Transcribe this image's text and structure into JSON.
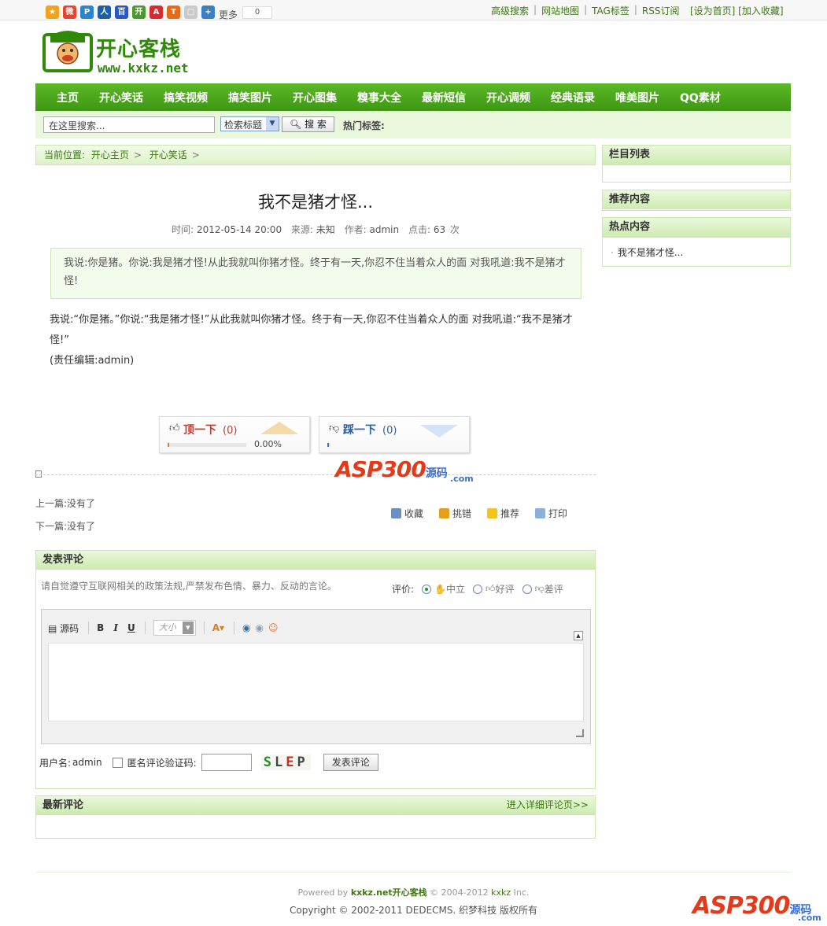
{
  "topbar": {
    "share_icons": [
      {
        "name": "qzone-icon",
        "color": "#f4a11c",
        "glyph": "★"
      },
      {
        "name": "weibo-icon",
        "color": "#e6442d",
        "glyph": "微"
      },
      {
        "name": "pengyou-icon",
        "color": "#2c84cf",
        "glyph": "P"
      },
      {
        "name": "renren-icon",
        "color": "#1f5ea8",
        "glyph": "人"
      },
      {
        "name": "baidu-icon",
        "color": "#2a57c4",
        "glyph": "百"
      },
      {
        "name": "kaixin-icon",
        "color": "#4a9a2a",
        "glyph": "开"
      },
      {
        "name": "sohu-icon",
        "color": "#d62c2c",
        "glyph": "A"
      },
      {
        "name": "taobao-icon",
        "color": "#e66a1a",
        "glyph": "T"
      },
      {
        "name": "copy-icon",
        "color": "#c9c9c9",
        "glyph": "□"
      },
      {
        "name": "more-share-icon",
        "color": "#3a80c9",
        "glyph": "+"
      }
    ],
    "more_label": "更多",
    "share_count": "0",
    "links": [
      "高级搜索",
      "网站地图",
      "TAG标签",
      "RSS订阅"
    ],
    "right_links": "[设为首页] [加入收藏]"
  },
  "logo": {
    "cn": "开心客栈",
    "en": "www.kxkz.net"
  },
  "nav": [
    "主页",
    "开心笑话",
    "搞笑视频",
    "搞笑图片",
    "开心图集",
    "糗事大全",
    "最新短信",
    "开心调频",
    "经典语录",
    "唯美图片",
    "QQ素材"
  ],
  "search": {
    "placeholder": "在这里搜索...",
    "select_value": "检索标题",
    "button": "搜 索",
    "hot_tags_label": "热门标签:"
  },
  "breadcrumb": {
    "prefix": "当前位置:",
    "items": [
      "开心主页",
      "开心笑话"
    ]
  },
  "article": {
    "title": "我不是猪才怪...",
    "meta_time_label": "时间:",
    "meta_time": "2012-05-14 20:00",
    "meta_source_label": "来源:",
    "meta_source": "未知",
    "meta_author_label": "作者:",
    "meta_author": "admin",
    "meta_clicks_label": "点击:",
    "meta_clicks": "63",
    "meta_clicks_unit": "次",
    "description": "我说:你是猪。你说:我是猪才怪!从此我就叫你猪才怪。终于有一天,你忍不住当着众人的面 对我吼道:我不是猪才怪!",
    "body_line1": "我说:“你是猪。”你说:“我是猪才怪!”从此我就叫你猪才怪。终于有一天,你忍不住当着众人的面 对我吼道:“我不是猪才怪!”",
    "body_editor": "(责任编辑:admin)"
  },
  "vote": {
    "up_label": "顶一下",
    "up_count": "(0)",
    "up_pct": "0.00%",
    "up_level": 0,
    "down_label": "踩一下",
    "down_count": "(0)",
    "down_level": 0,
    "up_color": "#c0392b",
    "down_color": "#2a5fa0"
  },
  "watermark": {
    "text": "ASP300",
    "zh": "源码",
    "com": ".com"
  },
  "prevnext": {
    "prev": "上一篇:没有了",
    "next": "下一篇:没有了"
  },
  "actions": [
    "收藏",
    "挑错",
    "推荐",
    "打印"
  ],
  "comment": {
    "header": "发表评论",
    "notice": "请自觉遵守互联网相关的政策法规,严禁发布色情、暴力、反动的言论。",
    "rating_label": "评价:",
    "rating_options": [
      "中立",
      "好评",
      "差评"
    ],
    "rating_selected": "中立",
    "toolbar_source": "源码",
    "toolbar_bold": "B",
    "toolbar_italic": "I",
    "toolbar_underline": "U",
    "toolbar_size": "大小",
    "username_label": "用户名:",
    "username": "admin",
    "anon_label": "匿名评论",
    "vcode_label": "验证码:",
    "captcha": [
      "S",
      "L",
      "E",
      "P"
    ],
    "submit": "发表评论"
  },
  "latest": {
    "header": "最新评论",
    "more": "进入详细评论页>>"
  },
  "sidebar": {
    "column_list": "栏目列表",
    "recommended": "推荐内容",
    "hot": "热点内容",
    "hot_items": [
      "我不是猪才怪..."
    ]
  },
  "footer": {
    "powered_prefix": "Powered by",
    "powered_site": "kxkz.net开心客栈",
    "powered_suffix": "© 2004-2012",
    "powered_brand": "kxkz",
    "powered_inc": "Inc.",
    "copyright": "Copyright © 2002-2011 DEDECMS. 织梦科技 版权所有"
  }
}
